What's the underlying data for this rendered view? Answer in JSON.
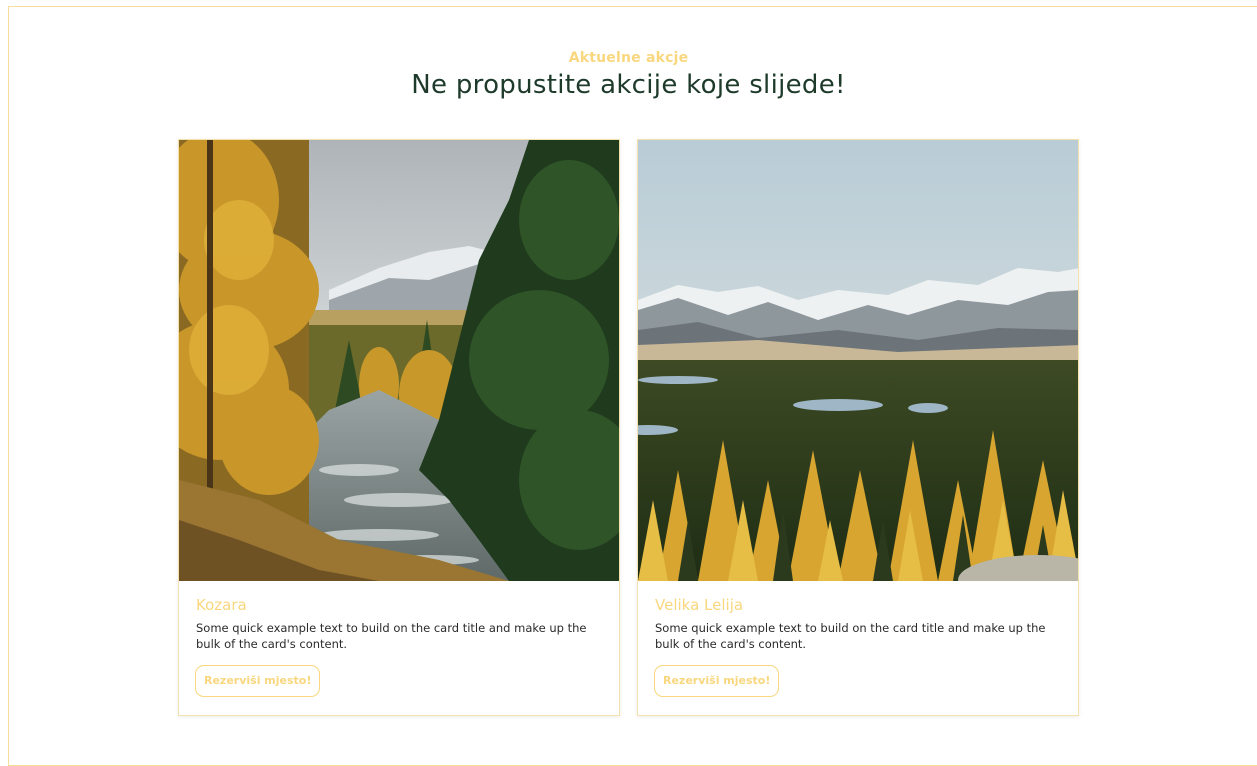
{
  "section": {
    "eyebrow": "Aktuelne akcje",
    "headline": "Ne propustite akcije koje slijede!"
  },
  "cards": [
    {
      "title": "Kozara",
      "text": "Some quick example text to build on the card title and make up the bulk of the card's content.",
      "button_label": "Rezerviši mjesto!",
      "image": "autumn-river-forest-photo"
    },
    {
      "title": "Velika Lelija",
      "text": "Some quick example text to build on the card title and make up the bulk of the card's content.",
      "button_label": "Rezerviši mjesto!",
      "image": "mountain-valley-forest-photo"
    }
  ],
  "colors": {
    "accent": "#f9d77f",
    "headline": "#1d3a2a",
    "border": "#f6de9a"
  }
}
